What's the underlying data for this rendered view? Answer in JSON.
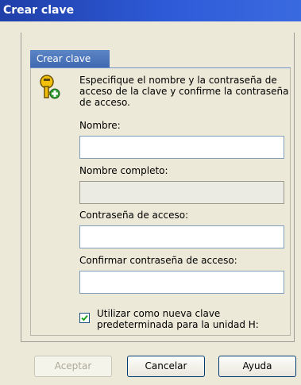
{
  "window": {
    "title": "Crear clave"
  },
  "tab": {
    "label": "Crear clave"
  },
  "description": "Especifique el nombre y la contraseña de acceso de la clave y confirme la contraseña de acceso.",
  "fields": {
    "nombre": {
      "label": "Nombre:",
      "value": ""
    },
    "nombre_completo": {
      "label": "Nombre completo:",
      "value": ""
    },
    "contrasena": {
      "label": "Contraseña de acceso:",
      "value": ""
    },
    "confirmar": {
      "label": "Confirmar contraseña de acceso:",
      "value": ""
    }
  },
  "checkbox": {
    "label": "Utilizar como nueva clave predeterminada para la unidad H:",
    "checked": true
  },
  "buttons": {
    "accept": "Aceptar",
    "cancel": "Cancelar",
    "help": "Ayuda"
  },
  "icons": {
    "key": "key-add-icon",
    "check": "checkmark-icon"
  },
  "colors": {
    "titlebar": "#2e5ad8",
    "tab": "#4f78bd",
    "dialog": "#ece9d8"
  }
}
